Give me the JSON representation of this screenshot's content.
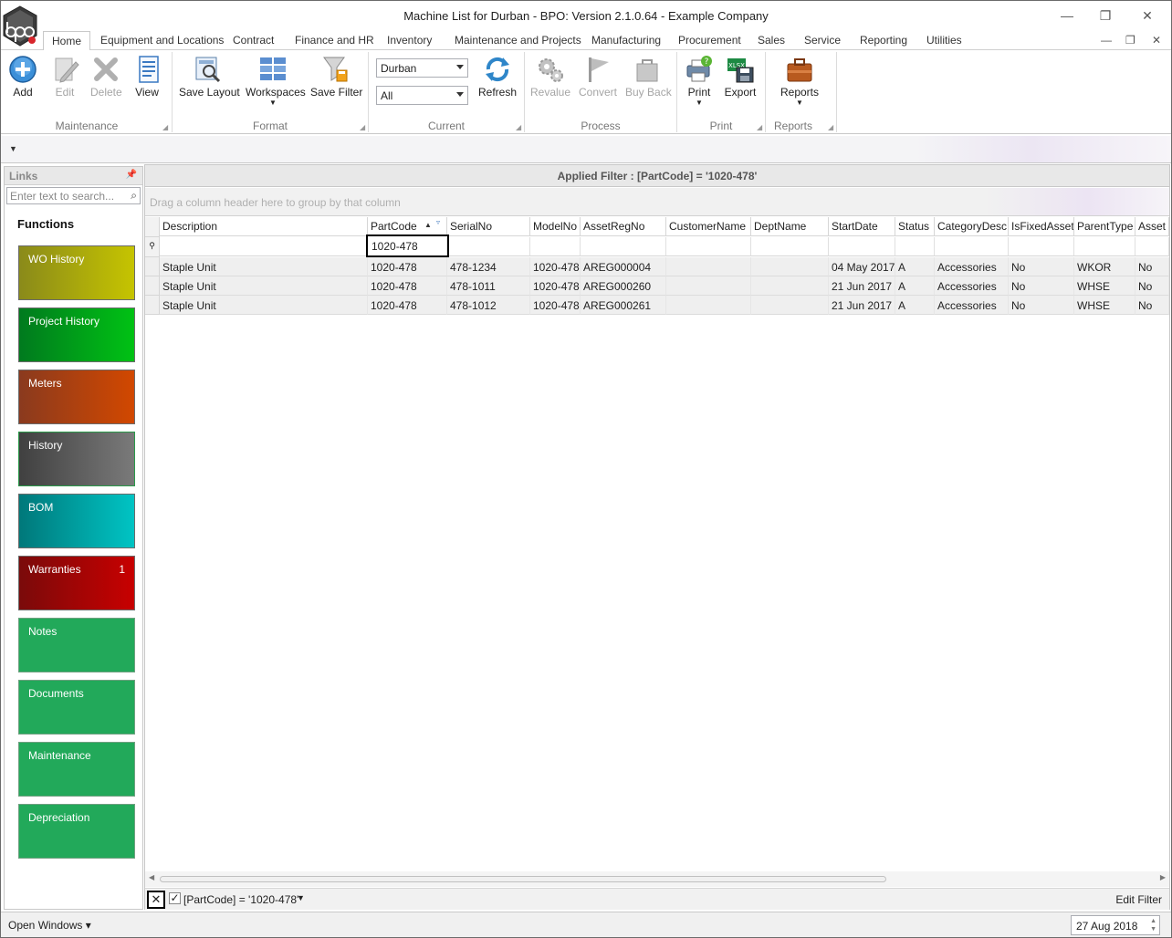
{
  "window": {
    "title": "Machine List for Durban - BPO: Version 2.1.0.64 - Example Company",
    "controls": {
      "minimize": "—",
      "restore": "❐",
      "close": "✕"
    }
  },
  "tabs": [
    "Home",
    "Equipment and Locations",
    "Contract",
    "Finance and HR",
    "Inventory",
    "Maintenance and Projects",
    "Manufacturing",
    "Procurement",
    "Sales",
    "Service",
    "Reporting",
    "Utilities"
  ],
  "mdi_controls": {
    "minimize": "—",
    "restore": "❐",
    "close": "✕"
  },
  "ribbon": {
    "maintenance": {
      "add": "Add",
      "edit": "Edit",
      "delete": "Delete",
      "view": "View",
      "label": "Maintenance"
    },
    "format": {
      "save_layout": "Save Layout",
      "workspaces": "Workspaces",
      "save_filter": "Save Filter",
      "label": "Format"
    },
    "current": {
      "site": "Durban",
      "status": "All",
      "refresh": "Refresh",
      "label": "Current"
    },
    "process": {
      "revalue": "Revalue",
      "convert": "Convert",
      "buy_back": "Buy Back",
      "label": "Process"
    },
    "print": {
      "print": "Print",
      "export": "Export",
      "label": "Print"
    },
    "reports": {
      "reports": "Reports",
      "label": "Reports"
    }
  },
  "links": {
    "title": "Links",
    "search_placeholder": "Enter text to search...",
    "functions_title": "Functions",
    "tiles": [
      {
        "label": "WO History",
        "count": ""
      },
      {
        "label": "Project History",
        "count": ""
      },
      {
        "label": "Meters",
        "count": ""
      },
      {
        "label": "History",
        "count": ""
      },
      {
        "label": "BOM",
        "count": ""
      },
      {
        "label": "Warranties",
        "count": "1"
      },
      {
        "label": "Notes",
        "count": ""
      },
      {
        "label": "Documents",
        "count": ""
      },
      {
        "label": "Maintenance",
        "count": ""
      },
      {
        "label": "Depreciation",
        "count": ""
      }
    ]
  },
  "grid": {
    "applied_filter": "Applied Filter : [PartCode] = '1020-478'",
    "group_hint": "Drag a column header here to group by that column",
    "columns": [
      "Description",
      "PartCode",
      "SerialNo",
      "ModelNo",
      "AssetRegNo",
      "CustomerName",
      "DeptName",
      "StartDate",
      "Status",
      "CategoryDesc",
      "IsFixedAsset",
      "ParentType",
      "Asset"
    ],
    "filter_row": {
      "PartCode": "1020-478"
    },
    "rows": [
      [
        "Staple Unit",
        "1020-478",
        "478-1234",
        "1020-478",
        "AREG000004",
        "",
        "",
        "04 May 2017",
        "A",
        "Accessories",
        "No",
        "WKOR",
        "No"
      ],
      [
        "Staple Unit",
        "1020-478",
        "478-1011",
        "1020-478",
        "AREG000260",
        "",
        "",
        "21 Jun 2017",
        "A",
        "Accessories",
        "No",
        "WHSE",
        "No"
      ],
      [
        "Staple Unit",
        "1020-478",
        "478-1012",
        "1020-478",
        "AREG000261",
        "",
        "",
        "21 Jun 2017",
        "A",
        "Accessories",
        "No",
        "WHSE",
        "No"
      ]
    ]
  },
  "filter_panel": {
    "expression": "[PartCode] = '1020-478'",
    "edit": "Edit Filter"
  },
  "status": {
    "open_windows": "Open Windows",
    "date": "27 Aug 2018"
  },
  "colors": {
    "tile_wo_history": "#b5b400",
    "tile_project_history": "#00b000",
    "tile_meters": "#c04a00",
    "tile_history": "#707070",
    "tile_bom": "#00b0b0",
    "tile_warranties": "#b00000",
    "tile_green": "#22a95a"
  }
}
